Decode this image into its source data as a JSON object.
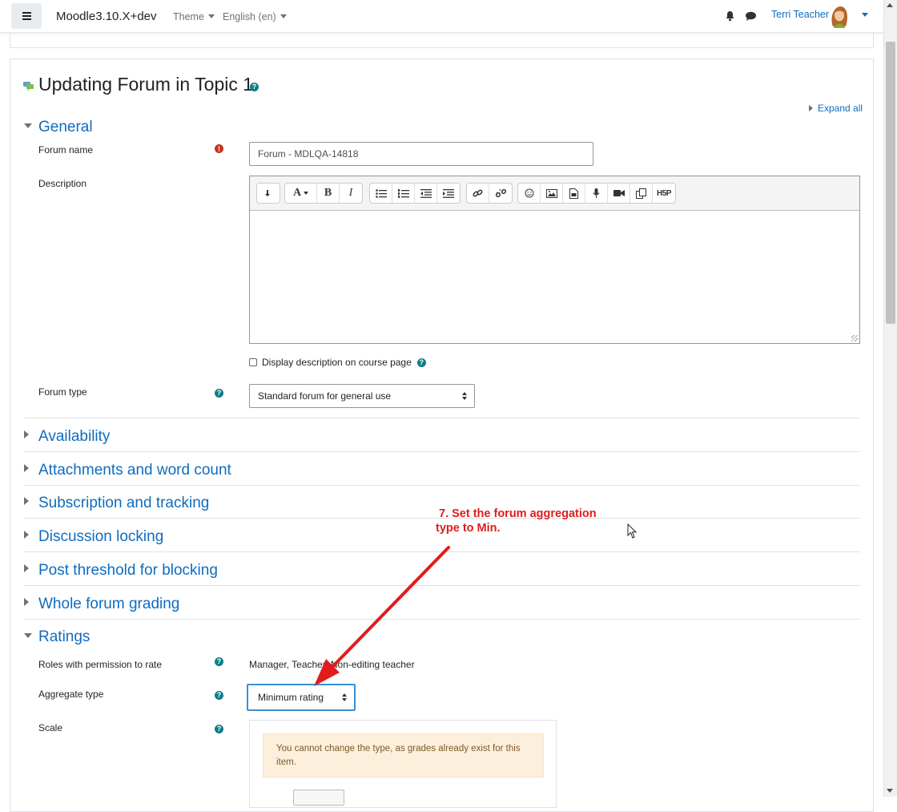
{
  "navbar": {
    "site_name": "Moodle3.10.X+dev",
    "theme_label": "Theme",
    "language_label": "English (en)",
    "user_name": "Terri Teacher"
  },
  "page": {
    "title": "Updating Forum in Topic 1",
    "expand_all": "Expand all"
  },
  "sections": {
    "general": "General",
    "availability": "Availability",
    "attachments": "Attachments and word count",
    "subscription": "Subscription and tracking",
    "locking": "Discussion locking",
    "threshold": "Post threshold for blocking",
    "grading": "Whole forum grading",
    "ratings": "Ratings"
  },
  "general": {
    "forum_name_label": "Forum name",
    "forum_name_value": "Forum - MDLQA-14818",
    "description_label": "Description",
    "display_description_label": "Display description on course page",
    "forum_type_label": "Forum type",
    "forum_type_value": "Standard forum for general use"
  },
  "editor_toolbar": {
    "groups": [
      [
        "collapse-icon"
      ],
      [
        "font-style-icon",
        "bold-icon",
        "italic-icon"
      ],
      [
        "unordered-list-icon",
        "ordered-list-icon",
        "outdent-icon",
        "indent-icon"
      ],
      [
        "link-icon",
        "unlink-icon"
      ],
      [
        "emoji-icon",
        "image-icon",
        "media-icon",
        "record-audio-icon",
        "record-video-icon",
        "manage-files-icon",
        "h5p-icon"
      ]
    ]
  },
  "ratings": {
    "roles_label": "Roles with permission to rate",
    "roles_value": "Manager, Teacher, Non-editing teacher",
    "aggregate_label": "Aggregate type",
    "aggregate_value": "Minimum rating",
    "scale_label": "Scale",
    "scale_warning": "You cannot change the type, as grades already exist for this item."
  },
  "annotation": {
    "line1": "7. Set the forum aggregation",
    "line2": "type to Min.",
    "color": "#e11c1c"
  },
  "colors": {
    "link": "#0f6cbf",
    "help": "#0b7e8b",
    "required": "#ca3120",
    "focus": "#3b8fd6"
  }
}
